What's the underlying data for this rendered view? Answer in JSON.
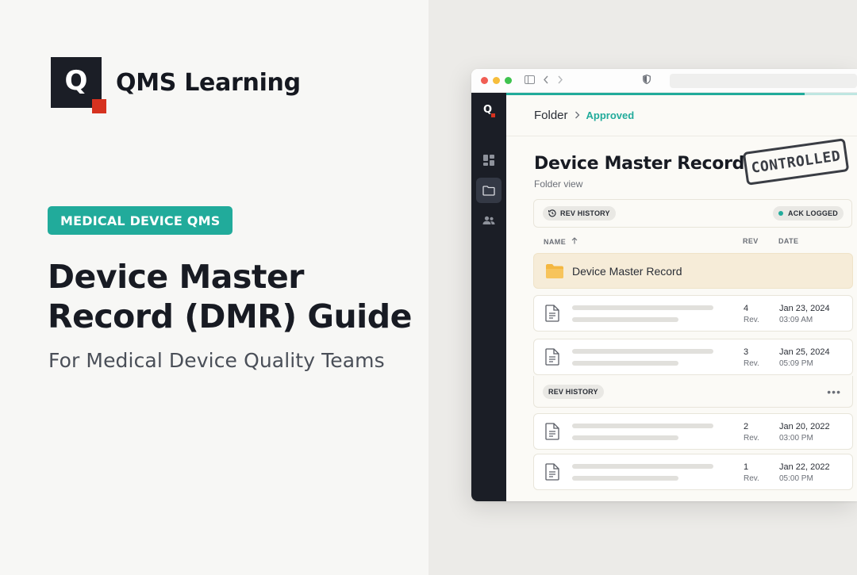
{
  "brand": {
    "logo_letter": "Q",
    "name": "QMS Learning",
    "accent": "#21ab9b",
    "red": "#d6321f",
    "dark": "#1b1e26"
  },
  "hero": {
    "tag": "MEDICAL DEVICE QMS",
    "title_line1": "Device Master",
    "title_line2": "Record (DMR) Guide",
    "subtitle": "For Medical Device Quality Teams"
  },
  "app": {
    "sidebar_logo": "Q",
    "sidebar_items": [
      {
        "name": "dashboard-icon"
      },
      {
        "name": "folder-icon",
        "active": true
      },
      {
        "name": "users-icon"
      }
    ],
    "breadcrumb": {
      "root": "Folder",
      "separator": ">",
      "current": "Approved"
    },
    "page_title": "Device Master Record",
    "page_subtitle": "Folder view",
    "stamp": "CONTROLLED",
    "toolbar": {
      "rev_history": "REV HISTORY",
      "ack_status": "ACK LOGGED"
    },
    "columns": {
      "name": "NAME",
      "rev": "REV",
      "date": "DATE"
    },
    "folder_row": {
      "label": "Device Master Record"
    },
    "documents": [
      {
        "rev": "4",
        "rev_label": "Rev.",
        "date": "Jan 23, 2024",
        "time": "03:09 AM"
      },
      {
        "rev": "3",
        "rev_label": "Rev.",
        "date": "Jan 25, 2024",
        "time": "05:09 PM"
      },
      {
        "rev": "2",
        "rev_label": "Rev.",
        "date": "Jan 20, 2022",
        "time": "03:00 PM"
      },
      {
        "rev": "1",
        "rev_label": "Rev.",
        "date": "Jan 22, 2022",
        "time": "05:00 PM"
      }
    ],
    "group_row": {
      "label": "REV HISTORY",
      "more": "•••"
    }
  }
}
